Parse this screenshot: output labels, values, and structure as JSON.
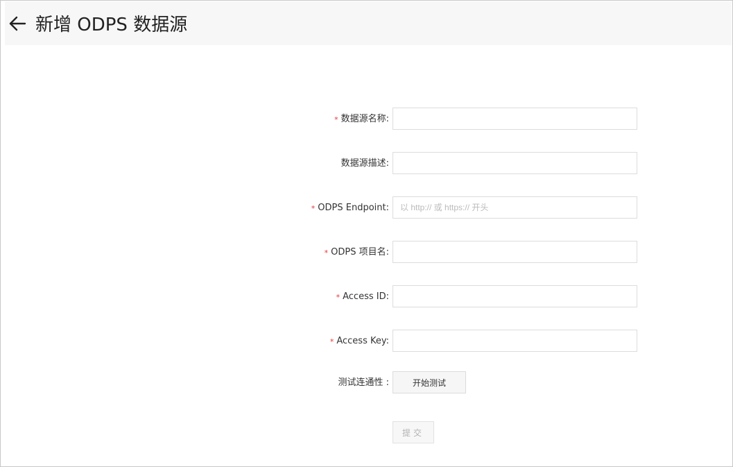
{
  "header": {
    "title": "新增 ODPS 数据源",
    "back_icon": "arrow-left-icon"
  },
  "form": {
    "fields": [
      {
        "label": "数据源名称",
        "required": true,
        "value": "",
        "placeholder": ""
      },
      {
        "label": "数据源描述",
        "required": false,
        "value": "",
        "placeholder": ""
      },
      {
        "label": "ODPS Endpoint",
        "required": true,
        "value": "",
        "placeholder": "以 http:// 或 https:// 开头"
      },
      {
        "label": "ODPS 项目名",
        "required": true,
        "value": "",
        "placeholder": ""
      },
      {
        "label": "Access ID",
        "required": true,
        "value": "",
        "placeholder": ""
      },
      {
        "label": "Access Key",
        "required": true,
        "value": "",
        "placeholder": ""
      }
    ],
    "required_mark": "*",
    "colon": ":",
    "connectivity": {
      "label": "测试连通性 :",
      "button_label": "开始测试"
    },
    "submit_label": "提交"
  },
  "colors": {
    "required": "#e4393c",
    "header_bg": "#f7f7f7",
    "border": "#dcdcdc"
  }
}
